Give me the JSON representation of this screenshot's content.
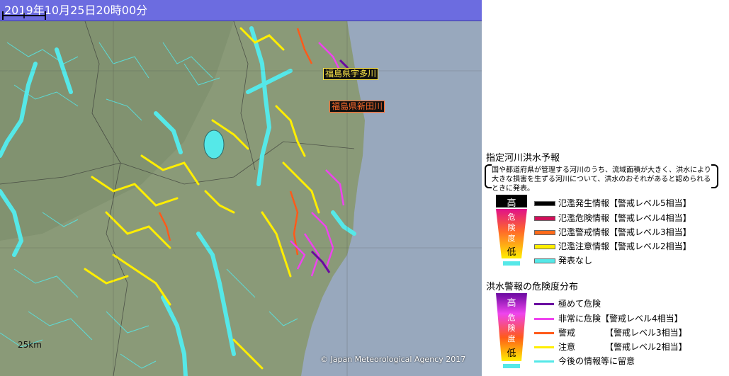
{
  "header": {
    "title": "2019年10月25日20時00分"
  },
  "map": {
    "river_labels": [
      {
        "text": "福島県宇多川"
      },
      {
        "text": "福島県新田川"
      }
    ],
    "scale_label": "25km",
    "copyright": "© Japan Meteorological Agency 2017",
    "colors": {
      "sea": "#98a8bd",
      "land": "#8a9a78",
      "river_none": "#55e8e8",
      "caution": "#ffee00",
      "warning": "#ff5a1a",
      "danger": "#ee44ee",
      "extreme": "#6a0aa0"
    }
  },
  "legend1": {
    "title": "指定河川洪水予報",
    "note": "国や都道府県が管理する河川のうち、流域面積が大きく、洪水により大きな損害を生ずる河川について、洪水のおそれがあると認められるときに発表。",
    "gradient_labels": [
      "高",
      "危",
      "険",
      "度",
      "低"
    ],
    "items": [
      {
        "label": "氾濫発生情報【警戒レベル5相当】",
        "color": "#000000"
      },
      {
        "label": "氾濫危険情報【警戒レベル4相当】",
        "color": "#d0105a"
      },
      {
        "label": "氾濫警戒情報【警戒レベル3相当】",
        "color": "#ff6a1a"
      },
      {
        "label": "氾濫注意情報【警戒レベル2相当】",
        "color": "#ffee00"
      },
      {
        "label": "発表なし",
        "color": "#55e8e8"
      }
    ]
  },
  "legend2": {
    "title": "洪水警報の危険度分布",
    "gradient_labels": [
      "高",
      "危",
      "険",
      "度",
      "低"
    ],
    "items": [
      {
        "label": "極めて危険",
        "color": "#6a0aa0"
      },
      {
        "label": "非常に危険【警戒レベル4相当】",
        "color": "#ee44ee"
      },
      {
        "label": "警戒　　　　【警戒レベル3相当】",
        "color": "#ff5a1a"
      },
      {
        "label": "注意　　　　【警戒レベル2相当】",
        "color": "#ffee00"
      },
      {
        "label": "今後の情報等に留意",
        "color": "#55e8e8"
      }
    ]
  }
}
